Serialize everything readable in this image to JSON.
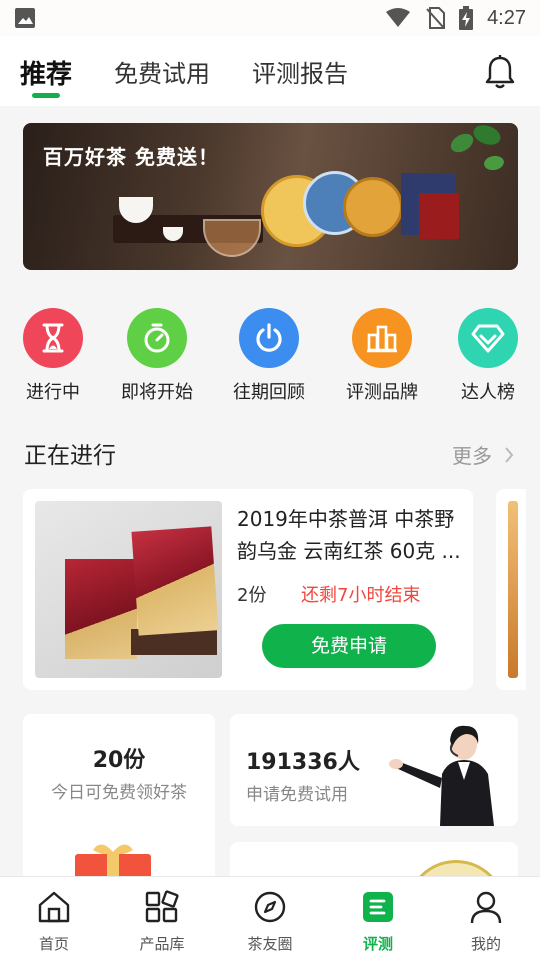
{
  "status_bar": {
    "time": "4:27"
  },
  "header": {
    "tabs": [
      {
        "label": "推荐",
        "active": true
      },
      {
        "label": "免费试用",
        "active": false
      },
      {
        "label": "评测报告",
        "active": false
      }
    ],
    "icons": [
      "notification-bell-icon"
    ]
  },
  "banner": {
    "headline": "百万好茶 免费送！"
  },
  "categories": [
    {
      "label": "进行中",
      "icon": "hourglass-icon",
      "color": "#f0465a"
    },
    {
      "label": "即将开始",
      "icon": "timer-icon",
      "color": "#5fcf45"
    },
    {
      "label": "往期回顾",
      "icon": "power-icon",
      "color": "#3b8ef0"
    },
    {
      "label": "评测品牌",
      "icon": "buildings-icon",
      "color": "#f79320"
    },
    {
      "label": "达人榜",
      "icon": "diamond-icon",
      "color": "#2fd4b1"
    }
  ],
  "ongoing": {
    "section_title": "正在进行",
    "more_label": "更多",
    "card": {
      "title": "2019年中茶普洱 中茶野韵乌金 云南红茶 60克 ...",
      "copies": "2份",
      "remaining": "还剩7小时结束",
      "apply_label": "免费申请"
    }
  },
  "stats": {
    "free_today": {
      "value": "20份",
      "label": "今日可免费领好茶"
    },
    "applicants": {
      "value": "191336人",
      "label": "申请免费试用"
    }
  },
  "bottom_nav": [
    {
      "label": "首页",
      "icon": "home-icon",
      "active": false
    },
    {
      "label": "产品库",
      "icon": "grid-icon",
      "active": false
    },
    {
      "label": "茶友圈",
      "icon": "compass-icon",
      "active": false
    },
    {
      "label": "评测",
      "icon": "review-icon",
      "active": true
    },
    {
      "label": "我的",
      "icon": "person-icon",
      "active": false
    }
  ],
  "colors": {
    "accent_green": "#10b24c",
    "warning_red": "#f0483e"
  }
}
